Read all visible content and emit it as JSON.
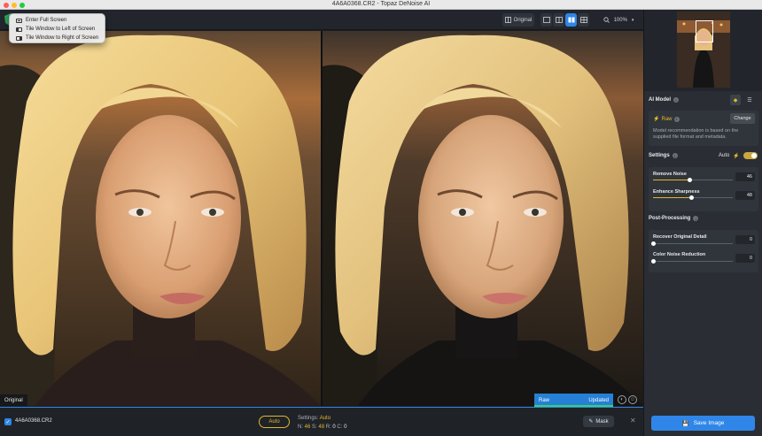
{
  "window": {
    "title": "4A6A0368.CR2 - Topaz DeNoise AI"
  },
  "context_menu": {
    "items": [
      {
        "label": "Enter Full Screen",
        "icon": "fullscreen-icon"
      },
      {
        "label": "Tile Window to Left of Screen",
        "icon": "tile-left-icon"
      },
      {
        "label": "Tile Window to Right of Screen",
        "icon": "tile-right-icon"
      }
    ]
  },
  "toolbar": {
    "original_label": "Original",
    "zoom_value": "100%",
    "view_modes": [
      "single-view",
      "split-view",
      "side-by-side-view",
      "quad-view"
    ],
    "active_view": "side-by-side-view"
  },
  "preview": {
    "original_label": "Original",
    "model_tag": "Raw",
    "status_tag": "Updated"
  },
  "bottom_bar": {
    "file_name": "4A6A0368.CR2",
    "auto_label": "Auto",
    "settings_label": "Settings:",
    "settings_mode": "Auto",
    "n_label": "N:",
    "n_value": "46",
    "s_label": "S:",
    "s_value": "48",
    "r_label": "R:",
    "r_value": "0",
    "c_label": "C:",
    "c_value": "0",
    "mask_label": "Mask",
    "close_glyph": "✕"
  },
  "sidebar": {
    "ai_model": {
      "title": "AI Model",
      "model_name": "Raw",
      "change_label": "Change",
      "note": "Model recommendation is based on the supplied file format and metadata."
    },
    "settings": {
      "title": "Settings",
      "auto_label": "Auto",
      "sliders": [
        {
          "label": "Remove Noise",
          "value": "46",
          "fraction": 0.46
        },
        {
          "label": "Enhance Sharpness",
          "value": "48",
          "fraction": 0.48
        }
      ]
    },
    "post_processing": {
      "title": "Post-Processing",
      "sliders": [
        {
          "label": "Recover Original Detail",
          "value": "0",
          "fraction": 0
        },
        {
          "label": "Color Noise Reduction",
          "value": "0",
          "fraction": 0
        }
      ]
    },
    "save_label": "Save Image"
  },
  "colors": {
    "accent_blue": "#2f86e8",
    "accent_yellow": "#e3b52b",
    "updated_green": "#3ccf6a"
  }
}
